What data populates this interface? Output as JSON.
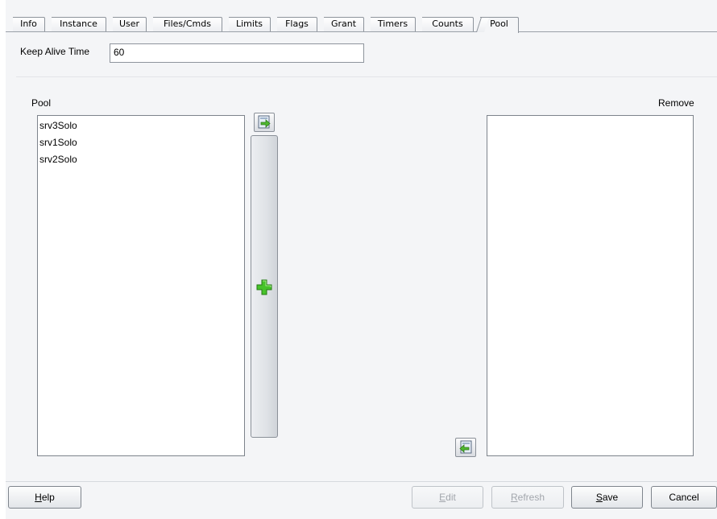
{
  "tabs": [
    {
      "label": "Info"
    },
    {
      "label": "Instance"
    },
    {
      "label": "User"
    },
    {
      "label": "Files/Cmds"
    },
    {
      "label": "Limits"
    },
    {
      "label": "Flags"
    },
    {
      "label": "Grant"
    },
    {
      "label": "Timers"
    },
    {
      "label": "Counts"
    },
    {
      "label": "Pool"
    }
  ],
  "active_tab": "Pool",
  "keep_alive": {
    "label": "Keep Alive Time",
    "value": "60"
  },
  "pool": {
    "label": "Pool",
    "items": [
      "srv3Solo",
      "srv1Solo",
      "srv2Solo"
    ]
  },
  "remove": {
    "label": "Remove",
    "items": []
  },
  "icons": {
    "move_right": "arrow-right-icon",
    "move_left": "arrow-left-icon",
    "add": "plus-icon"
  },
  "buttons": {
    "help": {
      "mnemonic": "H",
      "rest": "elp"
    },
    "edit": {
      "mnemonic": "E",
      "rest": "dit"
    },
    "refresh": {
      "mnemonic": "R",
      "rest": "efresh"
    },
    "save": {
      "mnemonic": "S",
      "rest": "ave"
    },
    "cancel": {
      "label": "Cancel"
    }
  }
}
